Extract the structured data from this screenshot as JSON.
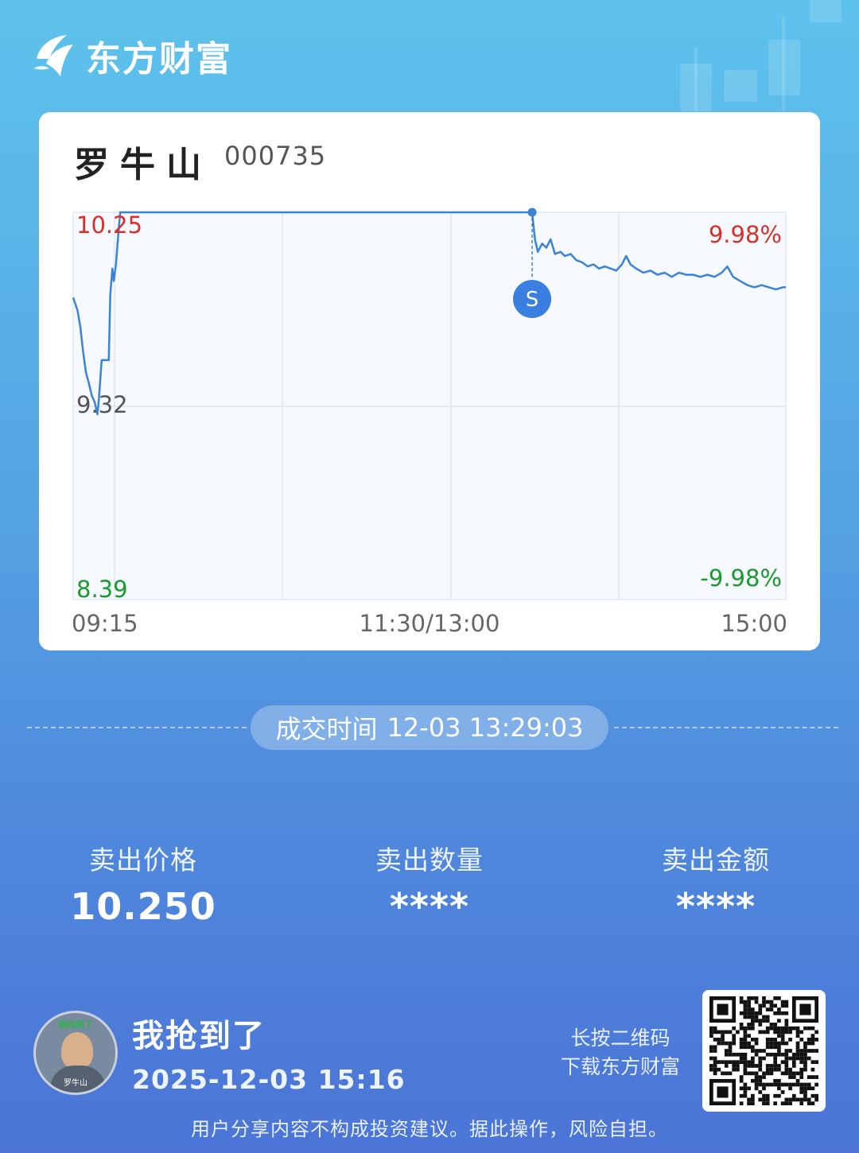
{
  "brand": {
    "name": "东方财富"
  },
  "stock": {
    "name": "罗牛山",
    "code": "000735"
  },
  "chart_data": {
    "type": "line",
    "y_max_label": "10.25",
    "y_mid_label": "9.32",
    "y_min_label": "8.39",
    "pct_max_label": "9.98%",
    "pct_min_label": "-9.98%",
    "ylim": [
      8.39,
      10.25
    ],
    "x_tick_labels": [
      "09:15",
      "11:30/13:00",
      "15:00"
    ],
    "sell_marker_label": "S",
    "sell_marker": {
      "x": 0.644,
      "y": 10.25
    },
    "series": [
      {
        "values": [
          [
            0.0,
            9.84
          ],
          [
            0.003,
            9.81
          ],
          [
            0.006,
            9.78
          ],
          [
            0.01,
            9.7
          ],
          [
            0.014,
            9.58
          ],
          [
            0.018,
            9.48
          ],
          [
            0.022,
            9.43
          ],
          [
            0.026,
            9.37
          ],
          [
            0.03,
            9.34
          ],
          [
            0.034,
            9.28
          ],
          [
            0.036,
            9.35
          ],
          [
            0.04,
            9.54
          ],
          [
            0.046,
            9.54
          ],
          [
            0.05,
            9.54
          ],
          [
            0.052,
            9.85
          ],
          [
            0.055,
            9.98
          ],
          [
            0.057,
            9.92
          ],
          [
            0.06,
            10.0
          ],
          [
            0.062,
            10.09
          ],
          [
            0.066,
            10.25
          ],
          [
            0.15,
            10.25
          ],
          [
            0.3,
            10.25
          ],
          [
            0.45,
            10.25
          ],
          [
            0.55,
            10.25
          ],
          [
            0.644,
            10.25
          ],
          [
            0.648,
            10.12
          ],
          [
            0.652,
            10.06
          ],
          [
            0.658,
            10.1
          ],
          [
            0.664,
            10.08
          ],
          [
            0.67,
            10.12
          ],
          [
            0.676,
            10.05
          ],
          [
            0.684,
            10.06
          ],
          [
            0.69,
            10.04
          ],
          [
            0.698,
            10.05
          ],
          [
            0.706,
            10.02
          ],
          [
            0.714,
            10.01
          ],
          [
            0.722,
            9.99
          ],
          [
            0.73,
            10.0
          ],
          [
            0.738,
            9.98
          ],
          [
            0.746,
            9.99
          ],
          [
            0.754,
            9.98
          ],
          [
            0.762,
            9.97
          ],
          [
            0.77,
            10.0
          ],
          [
            0.776,
            10.04
          ],
          [
            0.782,
            10.0
          ],
          [
            0.79,
            9.98
          ],
          [
            0.8,
            9.96
          ],
          [
            0.81,
            9.97
          ],
          [
            0.82,
            9.95
          ],
          [
            0.83,
            9.96
          ],
          [
            0.84,
            9.94
          ],
          [
            0.85,
            9.96
          ],
          [
            0.86,
            9.95
          ],
          [
            0.87,
            9.95
          ],
          [
            0.88,
            9.94
          ],
          [
            0.89,
            9.95
          ],
          [
            0.9,
            9.94
          ],
          [
            0.91,
            9.96
          ],
          [
            0.918,
            9.99
          ],
          [
            0.926,
            9.94
          ],
          [
            0.936,
            9.92
          ],
          [
            0.946,
            9.9
          ],
          [
            0.956,
            9.89
          ],
          [
            0.966,
            9.9
          ],
          [
            0.976,
            9.89
          ],
          [
            0.986,
            9.88
          ],
          [
            0.996,
            9.89
          ],
          [
            1.0,
            9.89
          ]
        ]
      }
    ]
  },
  "trade": {
    "label": "成交时间",
    "datetime": "12-03 13:29:03"
  },
  "stats": [
    {
      "label": "卖出价格",
      "value": "10.250"
    },
    {
      "label": "卖出数量",
      "value": "****"
    },
    {
      "label": "卖出金额",
      "value": "****"
    }
  ],
  "user": {
    "title": "我抢到了",
    "time": "2025-12-03 15:16",
    "avatar_caption_top": "我抢到了",
    "avatar_caption_bottom": "罗牛山"
  },
  "qr": {
    "hint_line1": "长按二维码",
    "hint_line2": "下载东方财富"
  },
  "disclaimer": "用户分享内容不构成投资建议。据此操作，风险自担。",
  "colors": {
    "up": "#d6302b",
    "down": "#1a9a2f",
    "line": "#3a83d5",
    "marker": "#3a7fe0"
  }
}
